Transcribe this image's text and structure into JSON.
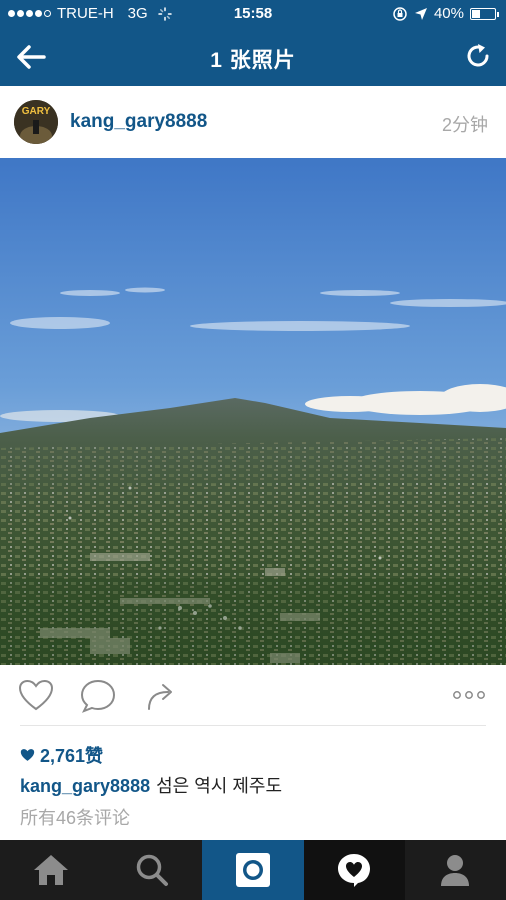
{
  "status_bar": {
    "carrier": "TRUE-H",
    "network": "3G",
    "time": "15:58",
    "battery": "40%",
    "battery_level": 0.4
  },
  "nav": {
    "title": "1 张照片"
  },
  "post": {
    "username": "kang_gary8888",
    "avatar_text": "GARY",
    "time_ago": "2分钟",
    "likes": "2,761赞",
    "caption_user": "kang_gary8888",
    "caption_text": "섬은 역시 제주도",
    "comments_link": "所有46条评论"
  },
  "colors": {
    "brand": "#125688",
    "tabbar": "#1c1c1c"
  },
  "tabs": [
    "home-icon",
    "search-icon",
    "camera-icon",
    "activity-icon",
    "profile-icon"
  ]
}
